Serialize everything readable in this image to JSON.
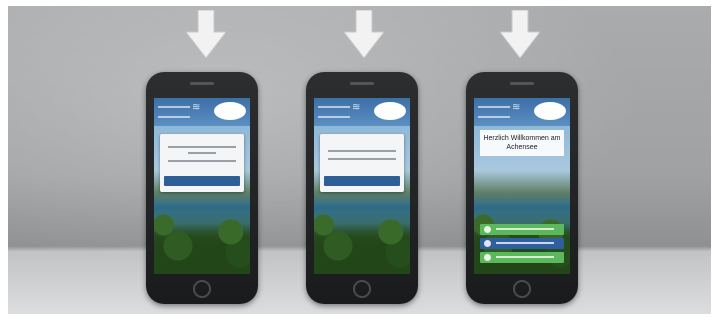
{
  "phones": [
    {
      "screen": "consent-dialog"
    },
    {
      "screen": "consent-dialog"
    },
    {
      "screen": "welcome",
      "welcome_text": "Herzlich Willkommen am Achensee",
      "menu_colors": [
        "#5cb85c",
        "#2f5f9e",
        "#5cb85c"
      ]
    }
  ],
  "colors": {
    "top_bar": "#3b6fa6",
    "dialog_button": "#2e5f97",
    "green_button": "#5cb85c",
    "blue_button": "#2f5f9e"
  },
  "icons": [
    "down-arrow-icon",
    "wifi-icon",
    "logo",
    "home-button"
  ]
}
